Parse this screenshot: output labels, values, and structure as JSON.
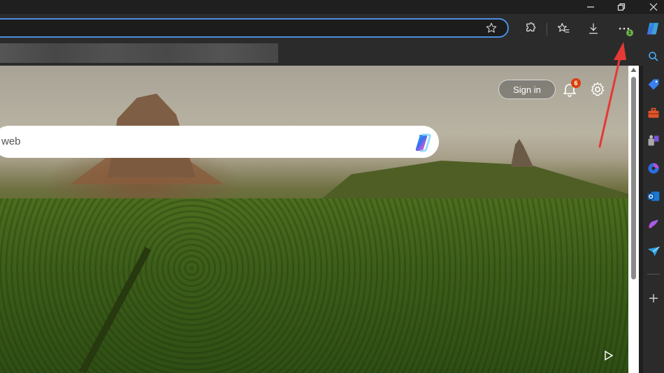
{
  "window": {
    "controls": [
      "minimize",
      "restore",
      "close"
    ]
  },
  "toolbar": {
    "address_value": "",
    "icons": [
      "favorite-star-icon",
      "extensions-icon",
      "favorites-icon",
      "downloads-icon",
      "more-options-icon",
      "copilot-icon"
    ],
    "more_badge": "1"
  },
  "newtab": {
    "signin_label": "Sign in",
    "notification_count": "6",
    "search_placeholder": "web"
  },
  "sidebar": {
    "icons": [
      "search-icon",
      "shopping-tag-icon",
      "tools-icon",
      "games-icon",
      "copilot-pro-icon",
      "outlook-icon",
      "designer-icon",
      "send-icon",
      "add-icon"
    ]
  },
  "colors": {
    "accent": "#4a90e2",
    "badge": "#d9400b",
    "arrow": "#e53935"
  }
}
